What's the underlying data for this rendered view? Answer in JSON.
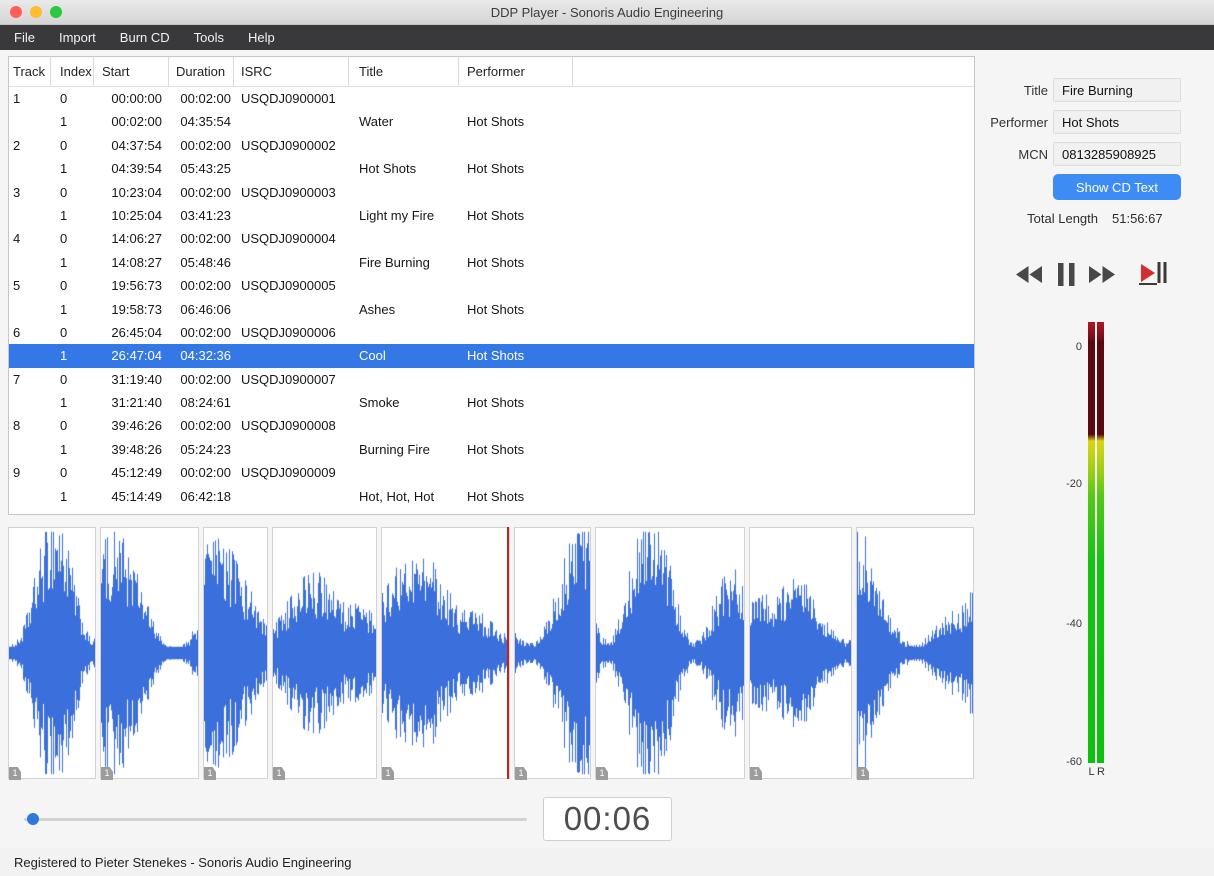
{
  "window": {
    "title": "DDP Player - Sonoris Audio Engineering"
  },
  "menu": {
    "items": [
      "File",
      "Import",
      "Burn CD",
      "Tools",
      "Help"
    ]
  },
  "table": {
    "columns": [
      "Track",
      "Index",
      "Start",
      "Duration",
      "ISRC",
      "Title",
      "Performer"
    ],
    "selected_row_index": 11,
    "rows": [
      {
        "track": "1",
        "index": "0",
        "start": "00:00:00",
        "duration": "00:02:00",
        "isrc": "USQDJ0900001",
        "title": "",
        "performer": ""
      },
      {
        "track": "",
        "index": "1",
        "start": "00:02:00",
        "duration": "04:35:54",
        "isrc": "",
        "title": "Water",
        "performer": "Hot Shots"
      },
      {
        "track": "2",
        "index": "0",
        "start": "04:37:54",
        "duration": "00:02:00",
        "isrc": "USQDJ0900002",
        "title": "",
        "performer": ""
      },
      {
        "track": "",
        "index": "1",
        "start": "04:39:54",
        "duration": "05:43:25",
        "isrc": "",
        "title": "Hot Shots",
        "performer": "Hot Shots"
      },
      {
        "track": "3",
        "index": "0",
        "start": "10:23:04",
        "duration": "00:02:00",
        "isrc": "USQDJ0900003",
        "title": "",
        "performer": ""
      },
      {
        "track": "",
        "index": "1",
        "start": "10:25:04",
        "duration": "03:41:23",
        "isrc": "",
        "title": "Light my Fire",
        "performer": "Hot Shots"
      },
      {
        "track": "4",
        "index": "0",
        "start": "14:06:27",
        "duration": "00:02:00",
        "isrc": "USQDJ0900004",
        "title": "",
        "performer": ""
      },
      {
        "track": "",
        "index": "1",
        "start": "14:08:27",
        "duration": "05:48:46",
        "isrc": "",
        "title": "Fire Burning",
        "performer": "Hot Shots"
      },
      {
        "track": "5",
        "index": "0",
        "start": "19:56:73",
        "duration": "00:02:00",
        "isrc": "USQDJ0900005",
        "title": "",
        "performer": ""
      },
      {
        "track": "",
        "index": "1",
        "start": "19:58:73",
        "duration": "06:46:06",
        "isrc": "",
        "title": "Ashes",
        "performer": "Hot Shots"
      },
      {
        "track": "6",
        "index": "0",
        "start": "26:45:04",
        "duration": "00:02:00",
        "isrc": "USQDJ0900006",
        "title": "",
        "performer": ""
      },
      {
        "track": "",
        "index": "1",
        "start": "26:47:04",
        "duration": "04:32:36",
        "isrc": "",
        "title": "Cool",
        "performer": "Hot Shots"
      },
      {
        "track": "7",
        "index": "0",
        "start": "31:19:40",
        "duration": "00:02:00",
        "isrc": "USQDJ0900007",
        "title": "",
        "performer": ""
      },
      {
        "track": "",
        "index": "1",
        "start": "31:21:40",
        "duration": "08:24:61",
        "isrc": "",
        "title": "Smoke",
        "performer": "Hot Shots"
      },
      {
        "track": "8",
        "index": "0",
        "start": "39:46:26",
        "duration": "00:02:00",
        "isrc": "USQDJ0900008",
        "title": "",
        "performer": ""
      },
      {
        "track": "",
        "index": "1",
        "start": "39:48:26",
        "duration": "05:24:23",
        "isrc": "",
        "title": "Burning Fire",
        "performer": "Hot Shots"
      },
      {
        "track": "9",
        "index": "0",
        "start": "45:12:49",
        "duration": "00:02:00",
        "isrc": "USQDJ0900009",
        "title": "",
        "performer": ""
      },
      {
        "track": "",
        "index": "1",
        "start": "45:14:49",
        "duration": "06:42:18",
        "isrc": "",
        "title": "Hot, Hot, Hot",
        "performer": "Hot Shots"
      }
    ]
  },
  "cd_text": {
    "title_label": "Title",
    "title_value": "Fire Burning",
    "performer_label": "Performer",
    "performer_value": "Hot Shots",
    "mcn_label": "MCN",
    "mcn_value": "0813285908925",
    "show_cd_text_button": "Show CD Text",
    "total_length_label": "Total Length",
    "total_length_value": "51:56:67"
  },
  "player": {
    "time_display": "00:06"
  },
  "meter": {
    "scale_labels": [
      "0",
      "-20",
      "-40",
      "-60"
    ],
    "channels": [
      "L",
      "R"
    ]
  },
  "waveform": {
    "marker_label": "1",
    "segment_widths": [
      88,
      99,
      65,
      105,
      129,
      77,
      150,
      103,
      118
    ]
  },
  "status_bar": {
    "text": "Registered to Pieter Stenekes - Sonoris Audio Engineering"
  },
  "colors": {
    "selection": "#3477e6",
    "waveform": "#3b6fdc",
    "accent_button": "#3d8cf5",
    "playhead": "#c32222"
  }
}
